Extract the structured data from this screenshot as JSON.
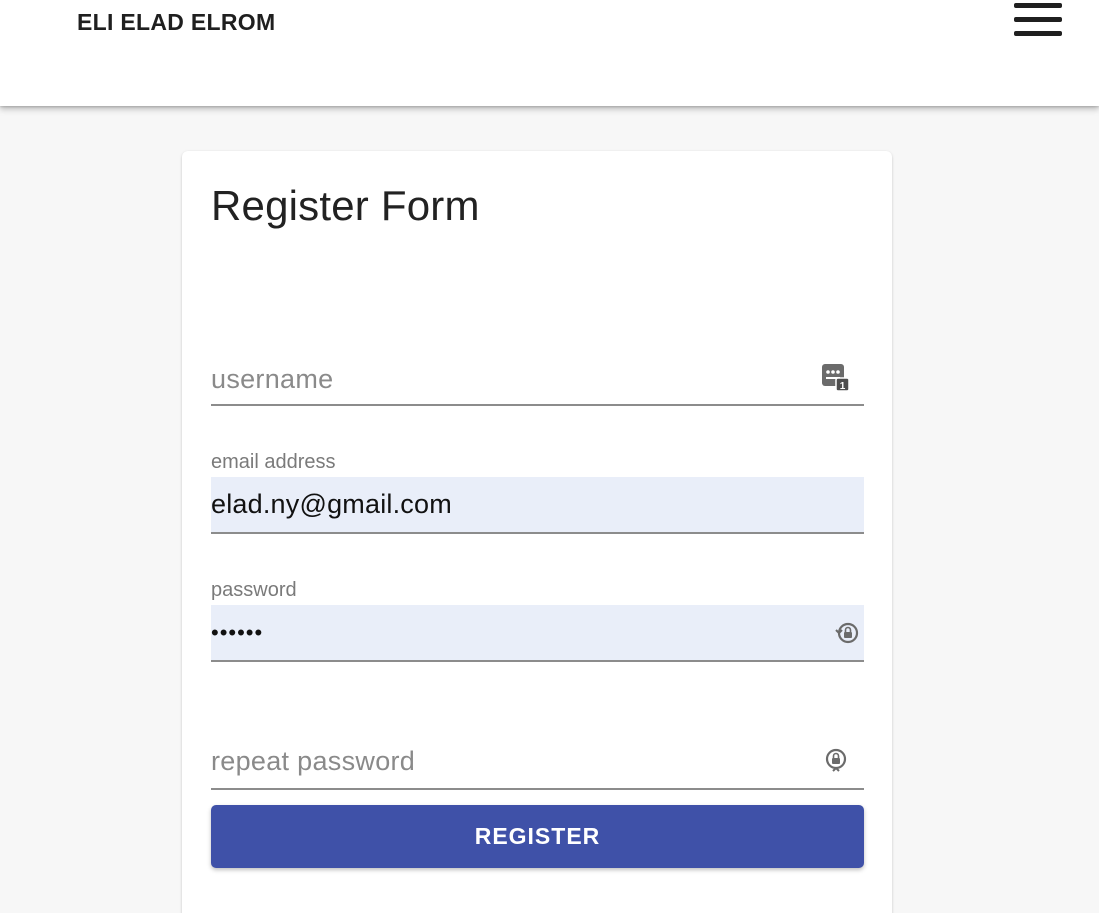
{
  "app": {
    "brand": "ELI ELAD ELROM",
    "menu_icon": "hamburger-menu-icon"
  },
  "form": {
    "title": "Register Form",
    "fields": {
      "username": {
        "placeholder": "username",
        "value": "",
        "icon": "password-manager-key-icon"
      },
      "email": {
        "label": "email address",
        "value": "elad.ny@gmail.com",
        "autofilled": true
      },
      "password": {
        "label": "password",
        "value_masked": "••••••",
        "autofilled": true,
        "icon": "password-generator-icon"
      },
      "repeat_password": {
        "placeholder": "repeat password",
        "value": "",
        "icon": "password-generator-icon"
      }
    },
    "submit_label": "REGISTER"
  },
  "colors": {
    "primary_button": "#3f51a8",
    "autofill_background": "#e9eef9",
    "page_background": "#f7f7f7"
  }
}
